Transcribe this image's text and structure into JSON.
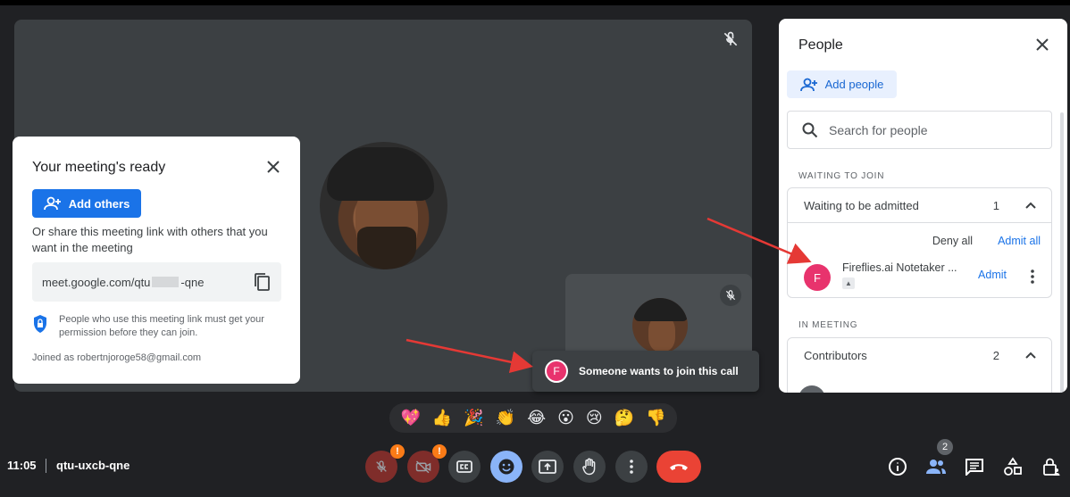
{
  "stage": {
    "self_tile_muted": true
  },
  "ready_card": {
    "title": "Your meeting's ready",
    "add_others_label": "Add others",
    "description": "Or share this meeting link with others that you want in the meeting",
    "link_prefix": "meet.google.com/qtu",
    "link_suffix": "-qne",
    "permission_text": "People who use this meeting link must get your permission before they can join.",
    "joined_as": "Joined as robertnjoroge58@gmail.com"
  },
  "toast": {
    "avatar_letter": "F",
    "text": "Someone wants to join this call"
  },
  "people_panel": {
    "title": "People",
    "add_people_label": "Add people",
    "search_placeholder": "Search for people",
    "waiting_section_label": "WAITING TO JOIN",
    "waiting_group": {
      "label": "Waiting to be admitted",
      "count": "1",
      "deny_all": "Deny all",
      "admit_all": "Admit all"
    },
    "waiting_people": [
      {
        "avatar_letter": "F",
        "name": "Fireflies.ai Notetaker ...",
        "admit_label": "Admit"
      }
    ],
    "in_meeting_section_label": "IN MEETING",
    "contributors_group": {
      "label": "Contributors",
      "count": "2"
    }
  },
  "reactions": [
    "💖",
    "👍",
    "🎉",
    "👏",
    "😂",
    "😮",
    "😢",
    "🤔",
    "👎"
  ],
  "bottom_bar": {
    "time": "11:05",
    "meeting_code": "qtu-uxcb-qne",
    "people_count": "2",
    "mic_warning": "!",
    "cam_warning": "!"
  },
  "colors": {
    "background": "#202124",
    "stage": "#3c4043",
    "accent_blue": "#1a73e8",
    "end_call_red": "#ea4335",
    "avatar_pink": "#e8336d",
    "warning_orange": "#fa7b17"
  }
}
